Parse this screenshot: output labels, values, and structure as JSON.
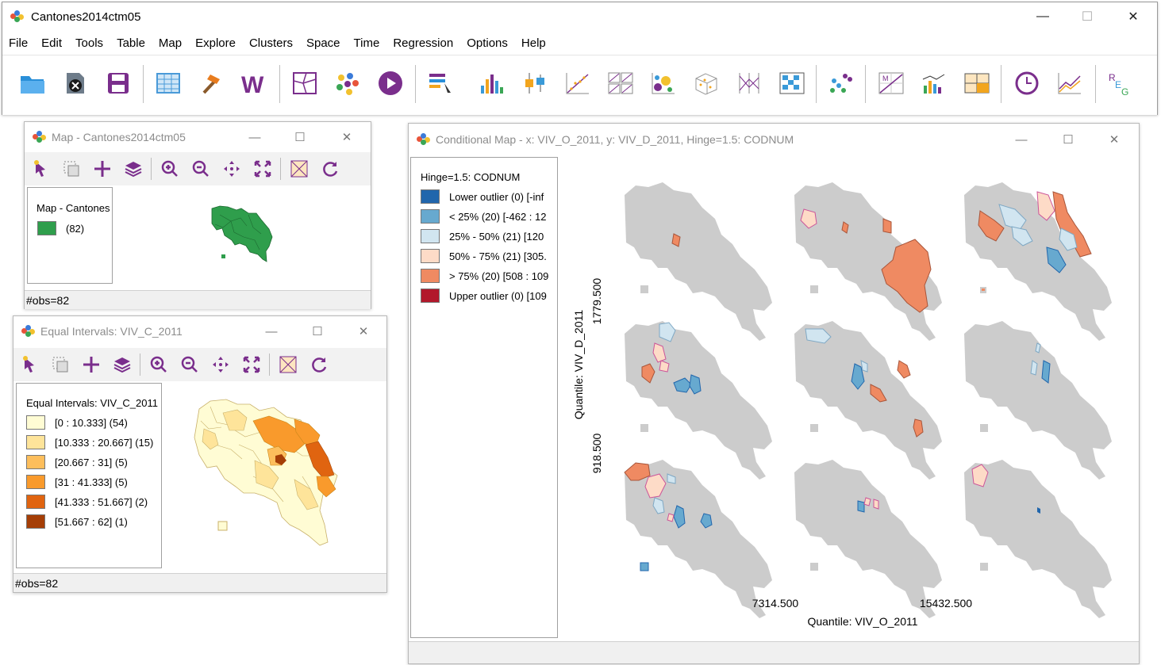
{
  "main": {
    "title": "Cantones2014ctm05",
    "menu": [
      "File",
      "Edit",
      "Tools",
      "Table",
      "Map",
      "Explore",
      "Clusters",
      "Space",
      "Time",
      "Regression",
      "Options",
      "Help"
    ],
    "controls": {
      "minimize": "—",
      "maximize": "☐",
      "close": "✕"
    }
  },
  "toolbar_icons": [
    "open-folder-icon",
    "close-file-icon",
    "save-icon",
    "table-icon",
    "hammer-tools-icon",
    "weights-icon",
    "map-icon",
    "cluster-map-icon",
    "play-icon",
    "category-editor-icon",
    "histogram-icon",
    "box-plot-icon",
    "scatter-plot-icon",
    "scatter-matrix-icon",
    "bubble-chart-icon",
    "3d-scatter-icon",
    "parallel-coordinates-icon",
    "conditional-plot-icon",
    "cluster-plot-icon",
    "moran-scatter-icon",
    "lisa-cluster-icon",
    "averages-chart-icon",
    "time-editor-icon",
    "line-chart-icon",
    "regression-icon"
  ],
  "map_window": {
    "title": "Map - Cantones2014ctm05",
    "legend_title": "Map - Cantones",
    "legend_items": [
      {
        "label": "(82)",
        "color": "#2f9e4c"
      }
    ],
    "status": "#obs=82"
  },
  "eq_window": {
    "title": "Equal Intervals: VIV_C_2011",
    "legend_title": "Equal Intervals: VIV_C_2011",
    "legend_items": [
      {
        "label": "[0 : 10.333] (54)",
        "color": "#fffcd4"
      },
      {
        "label": "[10.333 : 20.667] (15)",
        "color": "#fee49a"
      },
      {
        "label": "[20.667 : 31] (5)",
        "color": "#fdbe5c"
      },
      {
        "label": "[31 : 41.333] (5)",
        "color": "#f99a2c"
      },
      {
        "label": "[41.333 : 51.667] (2)",
        "color": "#e06410"
      },
      {
        "label": "[51.667 : 62] (1)",
        "color": "#a53e06"
      }
    ],
    "status": "#obs=82"
  },
  "cond_window": {
    "title": "Conditional Map - x: VIV_O_2011, y: VIV_D_2011, Hinge=1.5: CODNUM",
    "legend_title": "Hinge=1.5: CODNUM",
    "legend_items": [
      {
        "label": "Lower outlier (0)  [-inf",
        "color": "#2166ac"
      },
      {
        "label": "< 25% (20)  [-462 : 12",
        "color": "#67a9cf"
      },
      {
        "label": "25% - 50% (21)  [120",
        "color": "#d1e5f0"
      },
      {
        "label": "50% - 75% (21)  [305.",
        "color": "#fddbc7"
      },
      {
        "label": "> 75% (20)  [508 : 109",
        "color": "#ef8a62"
      },
      {
        "label": "Upper outlier (0)  [109",
        "color": "#b2182b"
      }
    ],
    "y_axis_label": "Quantile: VIV_D_2011",
    "y_ticks": [
      "1779.500",
      "918.500"
    ],
    "x_axis_label": "Quantile: VIV_O_2011",
    "x_ticks": [
      "7314.500",
      "15432.500"
    ]
  }
}
